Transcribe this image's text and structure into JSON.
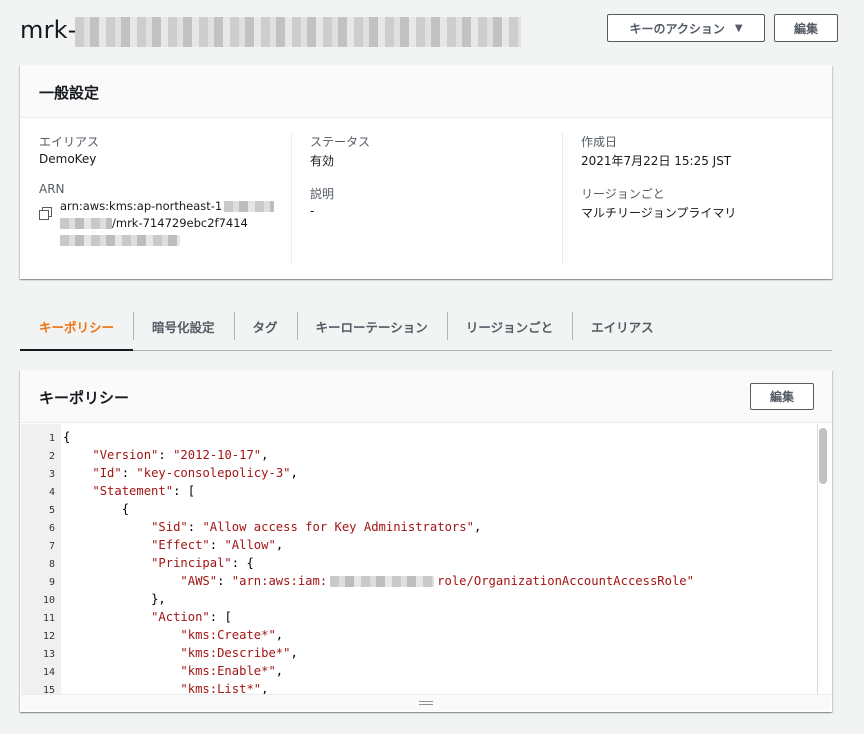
{
  "header": {
    "title_prefix": "mrk-",
    "actions_label": "キーのアクション",
    "edit_label": "編集"
  },
  "general": {
    "title": "一般設定",
    "alias_label": "エイリアス",
    "alias_value": "DemoKey",
    "arn_label": "ARN",
    "arn_line1": "arn:aws:kms:ap-northeast-1",
    "arn_line2": "/mrk-714729ebc2f7414",
    "status_label": "ステータス",
    "status_value": "有効",
    "description_label": "説明",
    "description_value": "-",
    "created_label": "作成日",
    "created_value": "2021年7月22日 15:25 JST",
    "region_label": "リージョンごと",
    "region_value": "マルチリージョンプライマリ"
  },
  "tabs": [
    {
      "label": "キーポリシー",
      "active": true
    },
    {
      "label": "暗号化設定",
      "active": false
    },
    {
      "label": "タグ",
      "active": false
    },
    {
      "label": "キーローテーション",
      "active": false
    },
    {
      "label": "リージョンごと",
      "active": false
    },
    {
      "label": "エイリアス",
      "active": false
    }
  ],
  "policy": {
    "title": "キーポリシー",
    "edit_label": "編集",
    "lines": [
      {
        "n": "1",
        "indent": 0,
        "parts": [
          [
            "p",
            "{"
          ]
        ]
      },
      {
        "n": "2",
        "indent": 1,
        "parts": [
          [
            "k",
            "\"Version\""
          ],
          [
            "p",
            ": "
          ],
          [
            "s",
            "\"2012-10-17\""
          ],
          [
            "p",
            ","
          ]
        ]
      },
      {
        "n": "3",
        "indent": 1,
        "parts": [
          [
            "k",
            "\"Id\""
          ],
          [
            "p",
            ": "
          ],
          [
            "s",
            "\"key-consolepolicy-3\""
          ],
          [
            "p",
            ","
          ]
        ]
      },
      {
        "n": "4",
        "indent": 1,
        "parts": [
          [
            "k",
            "\"Statement\""
          ],
          [
            "p",
            ": ["
          ]
        ]
      },
      {
        "n": "5",
        "indent": 2,
        "parts": [
          [
            "p",
            "{"
          ]
        ]
      },
      {
        "n": "6",
        "indent": 3,
        "parts": [
          [
            "k",
            "\"Sid\""
          ],
          [
            "p",
            ": "
          ],
          [
            "s",
            "\"Allow access for Key Administrators\""
          ],
          [
            "p",
            ","
          ]
        ]
      },
      {
        "n": "7",
        "indent": 3,
        "parts": [
          [
            "k",
            "\"Effect\""
          ],
          [
            "p",
            ": "
          ],
          [
            "s",
            "\"Allow\""
          ],
          [
            "p",
            ","
          ]
        ]
      },
      {
        "n": "8",
        "indent": 3,
        "parts": [
          [
            "k",
            "\"Principal\""
          ],
          [
            "p",
            ": {"
          ]
        ]
      },
      {
        "n": "9",
        "indent": 4,
        "parts": [
          [
            "k",
            "\"AWS\""
          ],
          [
            "p",
            ": "
          ],
          [
            "s",
            "\"arn:aws:iam:"
          ],
          [
            "r",
            ""
          ],
          [
            "s",
            "role/OrganizationAccountAccessRole\""
          ]
        ]
      },
      {
        "n": "10",
        "indent": 3,
        "parts": [
          [
            "p",
            "},"
          ]
        ]
      },
      {
        "n": "11",
        "indent": 3,
        "parts": [
          [
            "k",
            "\"Action\""
          ],
          [
            "p",
            ": ["
          ]
        ]
      },
      {
        "n": "12",
        "indent": 4,
        "parts": [
          [
            "s",
            "\"kms:Create*\""
          ],
          [
            "p",
            ","
          ]
        ]
      },
      {
        "n": "13",
        "indent": 4,
        "parts": [
          [
            "s",
            "\"kms:Describe*\""
          ],
          [
            "p",
            ","
          ]
        ]
      },
      {
        "n": "14",
        "indent": 4,
        "parts": [
          [
            "s",
            "\"kms:Enable*\""
          ],
          [
            "p",
            ","
          ]
        ]
      },
      {
        "n": "15",
        "indent": 4,
        "parts": [
          [
            "s",
            "\"kms:List*\""
          ],
          [
            "p",
            ","
          ]
        ]
      }
    ]
  },
  "icons": {
    "copy": "copy-icon",
    "caret": "caret-down-icon",
    "grip": "resize-grip-icon"
  }
}
